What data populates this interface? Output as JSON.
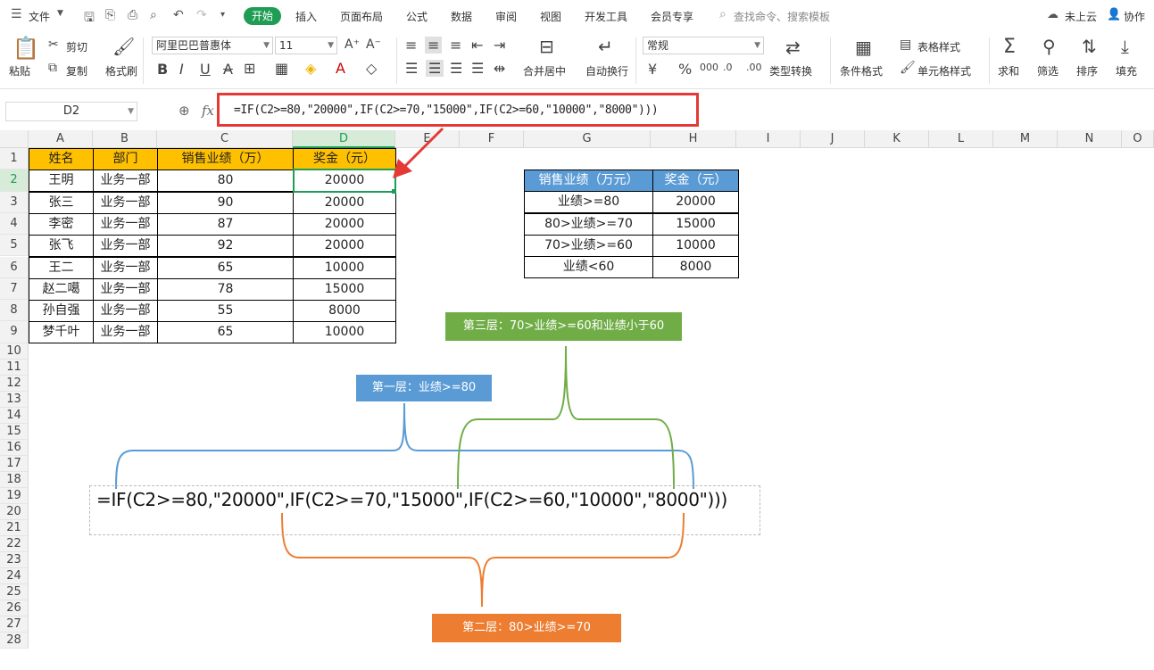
{
  "menubar": {
    "file": "文件",
    "tabs": [
      "开始",
      "插入",
      "页面布局",
      "公式",
      "数据",
      "审阅",
      "视图",
      "开发工具",
      "会员专享"
    ],
    "search_placeholder": "查找命令、搜索模板",
    "cloud": "未上云",
    "collab": "协作"
  },
  "ribbon": {
    "paste": "粘贴",
    "cut": "剪切",
    "copy": "复制",
    "format_painter": "格式刷",
    "font_name": "阿里巴巴普惠体",
    "font_size": "11",
    "merge_center": "合并居中",
    "wrap_text": "自动换行",
    "number_format": "常规",
    "type_convert": "类型转换",
    "cond_format": "条件格式",
    "table_style": "表格样式",
    "cell_style": "单元格样式",
    "sum": "求和",
    "filter": "筛选",
    "sort": "排序",
    "fill": "填充"
  },
  "formula_bar": {
    "cell_ref": "D2",
    "fx": "fx",
    "formula": "=IF(C2>=80,\"20000\",IF(C2>=70,\"15000\",IF(C2>=60,\"10000\",\"8000\")))"
  },
  "columns": [
    "A",
    "B",
    "C",
    "D",
    "E",
    "F",
    "G",
    "H",
    "I",
    "J",
    "K",
    "L",
    "M",
    "N",
    "O"
  ],
  "rows": [
    "1",
    "2",
    "3",
    "4",
    "5",
    "6",
    "7",
    "8",
    "9",
    "10",
    "11",
    "12",
    "13",
    "14",
    "15",
    "16",
    "17",
    "18",
    "19",
    "20",
    "21",
    "22",
    "23",
    "24",
    "25",
    "26",
    "27",
    "28"
  ],
  "main_table": {
    "headers": [
      "姓名",
      "部门",
      "销售业绩（万）",
      "奖金（元）"
    ],
    "rows": [
      [
        "王明",
        "业务一部",
        "80",
        "20000"
      ],
      [
        "张三",
        "业务一部",
        "90",
        "20000"
      ],
      [
        "李密",
        "业务一部",
        "87",
        "20000"
      ],
      [
        "张飞",
        "业务一部",
        "92",
        "20000"
      ],
      [
        "王二",
        "业务一部",
        "65",
        "10000"
      ],
      [
        "赵二噶",
        "业务一部",
        "78",
        "15000"
      ],
      [
        "孙自强",
        "业务一部",
        "55",
        "8000"
      ],
      [
        "梦千叶",
        "业务一部",
        "65",
        "10000"
      ]
    ]
  },
  "ref_table": {
    "headers": [
      "销售业绩（万元）",
      "奖金（元）"
    ],
    "rows": [
      [
        "业绩>=80",
        "20000"
      ],
      [
        "80>业绩>=70",
        "15000"
      ],
      [
        "70>业绩>=60",
        "10000"
      ],
      [
        "业绩<60",
        "8000"
      ]
    ]
  },
  "annotations": {
    "layer1": "第一层：业绩>=80",
    "layer2": "第二层：80>业绩>=70",
    "layer3": "第三层：70>业绩>=60和业绩小于60",
    "big_formula": "=IF(C2>=80,\"20000\",IF(C2>=70,\"15000\",IF(C2>=60,\"10000\",\"8000\")))"
  },
  "colors": {
    "accent_green": "#1f9d55",
    "header_orange": "#ffc000",
    "ref_blue": "#5b9bd5",
    "layer1_blue": "#5b9bd5",
    "layer2_orange": "#ed7d31",
    "layer3_green": "#70ad47",
    "highlight_red": "#e53935"
  }
}
